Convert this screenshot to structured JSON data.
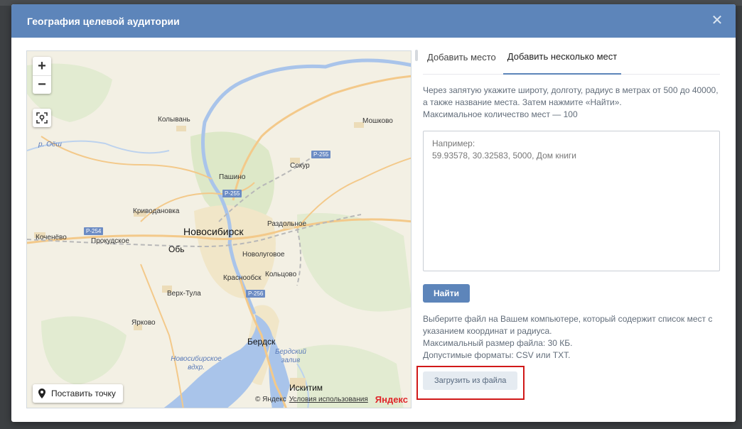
{
  "modal": {
    "title": "География целевой аудитории",
    "close_icon": "close-icon"
  },
  "map": {
    "zoom_in": "+",
    "zoom_out": "−",
    "place_point_label": "Поставить точку",
    "copyright": "© Яндекс",
    "terms": "Условия использования",
    "brand": "Яндекс",
    "cities": [
      {
        "name": "Колывань",
        "big": false
      },
      {
        "name": "Мошково",
        "big": false
      },
      {
        "name": "Сокур",
        "big": false
      },
      {
        "name": "Пашино",
        "big": false
      },
      {
        "name": "Криводановка",
        "big": false
      },
      {
        "name": "Новосибирск",
        "big": true
      },
      {
        "name": "Раздольное",
        "big": false
      },
      {
        "name": "Коченёво",
        "big": false
      },
      {
        "name": "Прокудское",
        "big": false
      },
      {
        "name": "Обь",
        "big": true
      },
      {
        "name": "Новолуговое",
        "big": false
      },
      {
        "name": "Краснообск",
        "big": false
      },
      {
        "name": "Кольцово",
        "big": false
      },
      {
        "name": "Верх-Тула",
        "big": false
      },
      {
        "name": "Ярково",
        "big": false
      },
      {
        "name": "Бердск",
        "big": true
      },
      {
        "name": "Искитим",
        "big": true
      }
    ],
    "water_labels": [
      "р. Оёш",
      "Новосибирское вдхр.",
      "Бердский залив"
    ],
    "roads": [
      "Р-255",
      "Р-255",
      "Р-254",
      "Р-256"
    ]
  },
  "tabs": [
    {
      "label": "Добавить место",
      "active": false
    },
    {
      "label": "Добавить несколько мест",
      "active": true
    }
  ],
  "description": [
    "Через запятую укажите широту, долготу, радиус в метрах от 500 до 40000,",
    "а также название места. Затем нажмите «Найти».",
    "Максимальное количество мест — 100"
  ],
  "textarea": {
    "placeholder": "Например:\n59.93578, 30.32583, 5000, Дом книги"
  },
  "find_button": "Найти",
  "file_description": [
    "Выберите файл на Вашем компьютере, который содержит список мест с",
    "указанием координат и радиуса.",
    "Максимальный размер файла: 30 КБ.",
    "Допустимые форматы: CSV или TXT."
  ],
  "upload_button": "Загрузить из файла",
  "colors": {
    "header": "#5d85ba",
    "accent": "#5d85ba",
    "highlight": "#d11919"
  }
}
